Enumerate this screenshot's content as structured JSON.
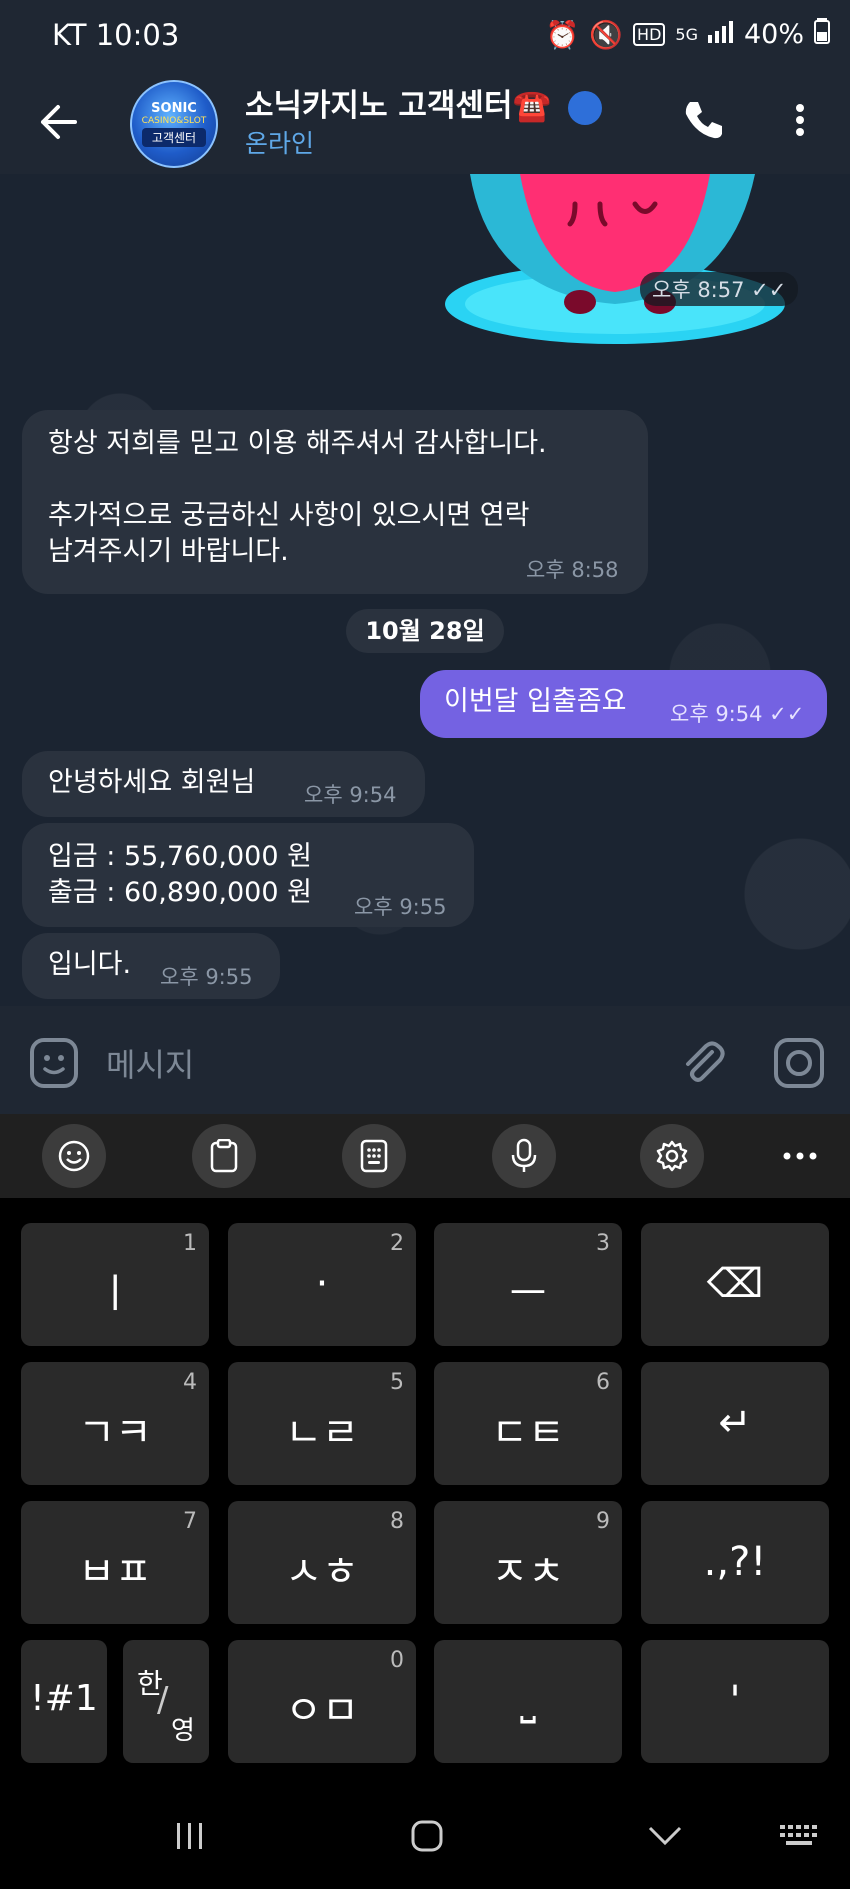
{
  "status_bar": {
    "carrier_time": "KT 10:03",
    "battery": "40%",
    "icons": [
      "image-icon",
      "alarm-icon",
      "mute-icon",
      "hd-icon",
      "5g-icon",
      "signal-icon",
      "battery-icon"
    ]
  },
  "header": {
    "title": "소닉카지노 고객센터☎️",
    "status": "온라인",
    "avatar_text_top": "SONIC",
    "avatar_text_sub": "CASINO&SLOT",
    "avatar_text_bottom": "고객센터"
  },
  "chat": {
    "sticker_time": "오후 8:57",
    "messages": [
      {
        "direction": "in",
        "lines": [
          "항상 저희를 믿고 이용 해주셔서 감사합니다.",
          "",
          "추가적으로 궁금하신 사항이 있으시면 연락",
          "남겨주시기 바랍니다."
        ],
        "time": "오후 8:58"
      },
      {
        "direction": "out",
        "lines": [
          "이번달 입출좀요"
        ],
        "time": "오후 9:54"
      },
      {
        "direction": "in",
        "lines": [
          "안녕하세요 회원님"
        ],
        "time": "오후 9:54"
      },
      {
        "direction": "in",
        "lines": [
          "입금 : 55,760,000 원",
          "출금 :  60,890,000 원"
        ],
        "time": "오후 9:55"
      },
      {
        "direction": "in",
        "lines": [
          "입니다."
        ],
        "time": "오후 9:55"
      }
    ],
    "date_divider": "10월 28일"
  },
  "composer": {
    "placeholder": "메시지"
  },
  "keyboard": {
    "toolbar_icons": [
      "emoji-icon",
      "clipboard-icon",
      "keypad-icon",
      "mic-icon",
      "settings-icon",
      "more-icon"
    ],
    "rows": [
      [
        {
          "label": "ㅣ",
          "num": "1"
        },
        {
          "label": "·",
          "num": "2"
        },
        {
          "label": "ㅡ",
          "num": "3"
        },
        {
          "label": "⌫",
          "num": ""
        }
      ],
      [
        {
          "label": "ㄱㅋ",
          "num": "4"
        },
        {
          "label": "ㄴㄹ",
          "num": "5"
        },
        {
          "label": "ㄷㅌ",
          "num": "6"
        },
        {
          "label": "↵",
          "num": ""
        }
      ],
      [
        {
          "label": "ㅂㅍ",
          "num": "7"
        },
        {
          "label": "ㅅㅎ",
          "num": "8"
        },
        {
          "label": "ㅈㅊ",
          "num": "9"
        },
        {
          "label": ".,?!",
          "num": ""
        }
      ]
    ],
    "bottom_row": {
      "symbols": "!#1",
      "lang_top": "한",
      "lang_bottom": "영",
      "zero_label": "ㅇㅁ",
      "zero_num": "0",
      "space": "⎵",
      "apostrophe": "'"
    }
  },
  "accent_colors": {
    "outgoing_bubble": "#7462e2",
    "header_status": "#5fa8e8"
  }
}
